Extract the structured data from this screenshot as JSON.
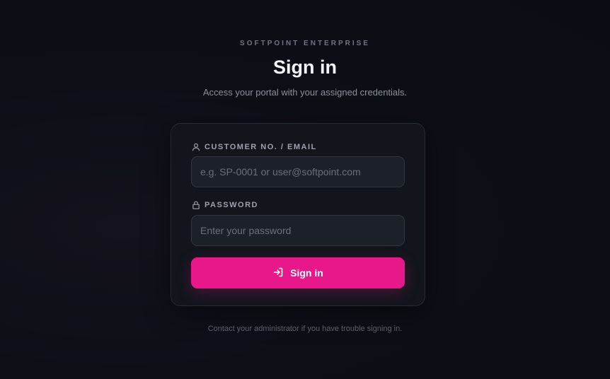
{
  "header": {
    "eyebrow": "SOFTPOINT ENTERPRISE",
    "title": "Sign in",
    "subtitle": "Access your portal with your assigned credentials."
  },
  "form": {
    "customer_label": "CUSTOMER NO. / EMAIL",
    "customer_icon": "user-icon",
    "customer_placeholder": "e.g. SP-0001 or user@softpoint.com",
    "customer_value": "",
    "password_label": "PASSWORD",
    "password_icon": "lock-icon",
    "password_placeholder": "Enter your password",
    "password_value": "",
    "submit_label": "Sign in",
    "submit_icon": "login-icon"
  },
  "footer": {
    "note": "Contact your administrator if you have trouble signing in."
  },
  "colors": {
    "accent": "#e8178a",
    "background": "#0b0e15",
    "card": "#12151c"
  }
}
